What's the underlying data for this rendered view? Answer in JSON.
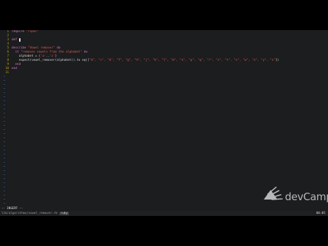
{
  "editor": {
    "lines": [
      {
        "num": "1",
        "parts": [
          {
            "t": "require ",
            "c": "kw"
          },
          {
            "t": "\"rspec\"",
            "c": "str"
          }
        ]
      },
      {
        "num": "2",
        "parts": []
      },
      {
        "num": "3",
        "parts": [
          {
            "t": "def ",
            "c": "kw"
          },
          {
            "t": " ",
            "c": "cursor"
          }
        ]
      },
      {
        "num": "4",
        "parts": []
      },
      {
        "num": "5",
        "parts": [
          {
            "t": "describe ",
            "c": "kw"
          },
          {
            "t": "\"Vowel remover\"",
            "c": "str"
          },
          {
            "t": " do",
            "c": "kw"
          }
        ]
      },
      {
        "num": "6",
        "parts": [
          {
            "t": "  it ",
            "c": "kw"
          },
          {
            "t": "\"removes vowels from the alphabet\"",
            "c": "str"
          },
          {
            "t": " do",
            "c": "kw"
          }
        ]
      },
      {
        "num": "7",
        "parts": [
          {
            "t": "    alphabet = (",
            "c": "fn"
          },
          {
            "t": "'a'",
            "c": "str"
          },
          {
            "t": "..",
            "c": "fn"
          },
          {
            "t": "'z'",
            "c": "str"
          },
          {
            "t": ")",
            "c": "fn"
          }
        ]
      },
      {
        "num": "8",
        "parts": [
          {
            "t": "    expect(vowel_remover(alphabet)).to eq([",
            "c": "fn"
          },
          {
            "t": "\"b\", \"c\", \"d\", \"f\", \"g\", \"h\", \"j\", \"k\", \"l\", \"m\", \"n\", \"p\", \"q\", \"r\", \"s\", \"t\", \"v\", \"w\", \"x\", \"y\", \"z\"",
            "c": "str"
          },
          {
            "t": "])",
            "c": "fn"
          }
        ]
      },
      {
        "num": "9",
        "parts": [
          {
            "t": "  end",
            "c": "kw"
          }
        ]
      },
      {
        "num": "10",
        "parts": [
          {
            "t": "end",
            "c": "kw"
          }
        ]
      },
      {
        "num": "11",
        "parts": []
      }
    ],
    "tilde_char": "~",
    "tilde_count": 32
  },
  "mode_line": "-- INSERT --",
  "status_bar": {
    "path": "lib/algorithms/vowel_remover.rb",
    "tab": "ruby",
    "time": "00:05"
  },
  "watermark": {
    "text": "devCamp",
    "icon": "devcamp-logo-icon"
  },
  "colors": {
    "background": "#1b1d1e",
    "line_number": "#c8a227",
    "keyword": "#e07ad0",
    "string": "#e25a5a",
    "tilde": "#4a7fd1"
  }
}
